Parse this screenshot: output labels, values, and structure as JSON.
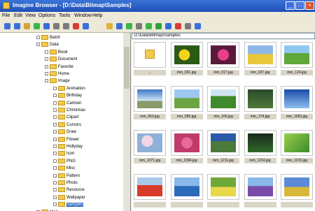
{
  "window": {
    "title": "Imagine Browser - [D:\\Data\\Bitmap\\Samples]",
    "controls": [
      "minimize-icon",
      "maximize-icon",
      "close-icon"
    ]
  },
  "menu": [
    "File",
    "Edit",
    "View",
    "Options",
    "Tools",
    "Window",
    "Help"
  ],
  "toolbar": {
    "icons": [
      "back-icon",
      "forward-icon",
      "up-icon",
      "refresh-icon",
      "home-icon",
      "copy-icon",
      "paste-icon",
      "delete-icon",
      "view-icon",
      "folder-icon",
      "zoom-icon",
      "rotate-icon",
      "settings-icon",
      "play-icon",
      "green-icon",
      "blue-icon",
      "red-icon",
      "print-icon",
      "help-icon"
    ]
  },
  "tree": [
    {
      "label": "Batch",
      "level": 1,
      "expanded": false
    },
    {
      "label": "Data",
      "level": 1,
      "expanded": true
    },
    {
      "label": "Book",
      "level": 2,
      "expanded": false
    },
    {
      "label": "Document",
      "level": 2,
      "expanded": false
    },
    {
      "label": "Favorite",
      "level": 2,
      "expanded": false
    },
    {
      "label": "Home",
      "level": 2,
      "expanded": false
    },
    {
      "label": "Image",
      "level": 2,
      "expanded": true
    },
    {
      "label": "Animation",
      "level": 3,
      "expanded": false
    },
    {
      "label": "Birthday",
      "level": 3,
      "expanded": false
    },
    {
      "label": "Cartoon",
      "level": 3,
      "expanded": false
    },
    {
      "label": "Christmas",
      "level": 3,
      "expanded": false
    },
    {
      "label": "Clipart",
      "level": 3,
      "expanded": false
    },
    {
      "label": "Cursors",
      "level": 3,
      "expanded": false
    },
    {
      "label": "Draw",
      "level": 3,
      "expanded": false
    },
    {
      "label": "Flower",
      "level": 3,
      "expanded": false
    },
    {
      "label": "Hollyday",
      "level": 3,
      "expanded": false
    },
    {
      "label": "Icon",
      "level": 3,
      "expanded": false
    },
    {
      "label": "PNG",
      "level": 3,
      "expanded": false
    },
    {
      "label": "Misc",
      "level": 3,
      "expanded": false
    },
    {
      "label": "Pattern",
      "level": 3,
      "expanded": false
    },
    {
      "label": "Photo",
      "level": 3,
      "expanded": false
    },
    {
      "label": "Resource",
      "level": 3,
      "expanded": false
    },
    {
      "label": "Wallpaper",
      "level": 3,
      "expanded": false
    },
    {
      "label": "samples",
      "level": 3,
      "expanded": false,
      "selected": true
    },
    {
      "label": "Mail",
      "level": 1,
      "expanded": false
    }
  ],
  "path": "D:\\Data\\Bitmap\\Samples",
  "thumbnails": [
    {
      "caption": "..",
      "kind": "folder"
    },
    {
      "caption": "mm_001.jpg",
      "kind": "yellow-flower"
    },
    {
      "caption": "mm_017.jpg",
      "kind": "pink-flower"
    },
    {
      "caption": "mm_027.jpg",
      "kind": "field"
    },
    {
      "caption": "mm_124.jpg",
      "kind": "meadow"
    },
    {
      "caption": "mm_063.jpg",
      "kind": "sky"
    },
    {
      "caption": "mm_065.jpg",
      "kind": "hills"
    },
    {
      "caption": "mm_166.jpg",
      "kind": "green-hills"
    },
    {
      "caption": "mm_174.jpg",
      "kind": "dark-green"
    },
    {
      "caption": "mm_1093.jpg",
      "kind": "blue-sky"
    },
    {
      "caption": "mm_1071.jpg",
      "kind": "blossom"
    },
    {
      "caption": "mm_1094.jpg",
      "kind": "pink-blossom"
    },
    {
      "caption": "mm_1211.jpg",
      "kind": "valley"
    },
    {
      "caption": "mm_1214.jpg",
      "kind": "forest"
    },
    {
      "caption": "mm_1215.jpg",
      "kind": "leaves"
    },
    {
      "caption": "",
      "kind": "red-field"
    },
    {
      "caption": "",
      "kind": "lake"
    },
    {
      "caption": "",
      "kind": "flowers"
    },
    {
      "caption": "",
      "kind": "purple-field"
    },
    {
      "caption": "",
      "kind": "sky-field"
    }
  ],
  "colors": {
    "titlebar": "#1f4fb7",
    "selection": "#316ac5",
    "folder": "#f2c94c"
  }
}
